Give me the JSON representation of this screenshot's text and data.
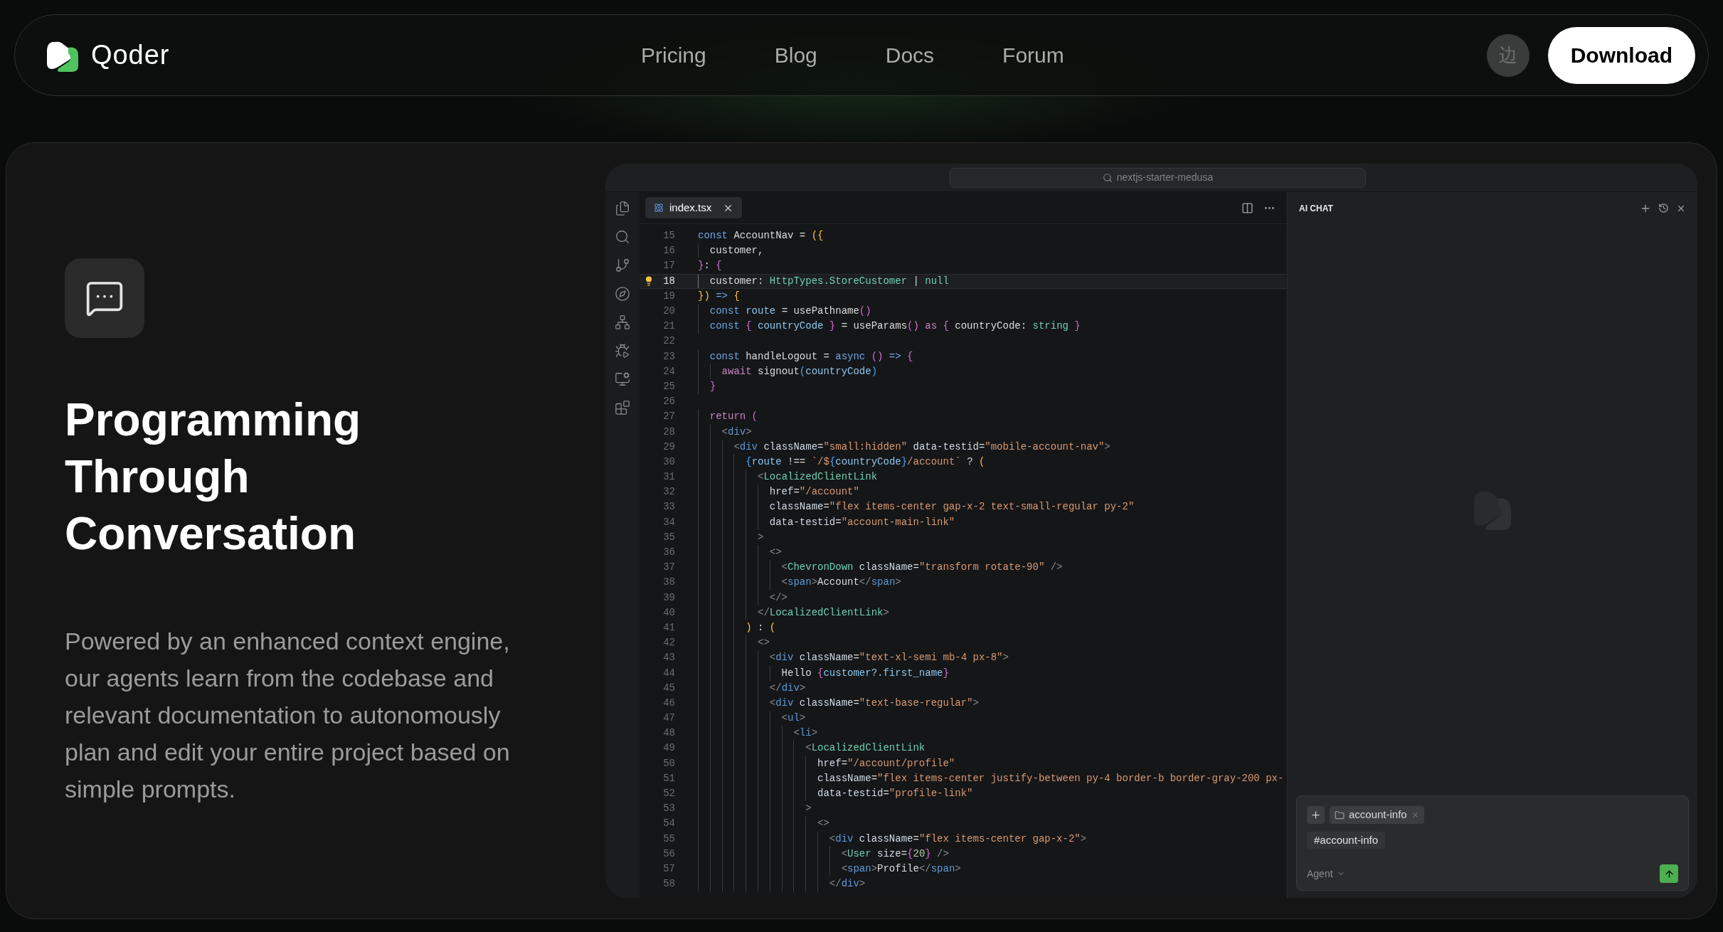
{
  "nav": {
    "brand": "Qoder",
    "links": [
      "Pricing",
      "Blog",
      "Docs",
      "Forum"
    ],
    "language_button": "边",
    "download_button": "Download"
  },
  "feature": {
    "title": "Programming Through Conversation",
    "description": "Powered by an enhanced context engine, our agents learn from the codebase and relevant documentation to autonomously plan and edit your entire project based on simple prompts."
  },
  "editor": {
    "search": "nextjs-starter-medusa",
    "tabs": [
      {
        "label": "index.tsx",
        "selected": true
      }
    ],
    "lines": [
      {
        "number": "15",
        "current": false,
        "tokens": [
          {
            "text": "const",
            "kind": "kw"
          },
          {
            "text": " AccountNav = ",
            "kind": "id"
          },
          {
            "text": "({",
            "kind": "b1"
          }
        ]
      },
      {
        "number": "16",
        "current": false,
        "tokens": [
          {
            "text": "  customer,",
            "kind": "id"
          }
        ]
      },
      {
        "number": "17",
        "current": false,
        "tokens": [
          {
            "text": "}",
            "kind": "b2"
          },
          {
            "text": ": ",
            "kind": "id"
          },
          {
            "text": "{",
            "kind": "b2"
          }
        ]
      },
      {
        "number": "18",
        "current": true,
        "tokens": [
          {
            "text": "  customer: ",
            "kind": "id"
          },
          {
            "text": "HttpTypes.StoreCustomer",
            "kind": "type"
          },
          {
            "text": " | ",
            "kind": "id"
          },
          {
            "text": "null",
            "kind": "type"
          }
        ]
      },
      {
        "number": "19",
        "current": false,
        "tokens": [
          {
            "text": "})",
            "kind": "b1"
          },
          {
            "text": " => ",
            "kind": "kw"
          },
          {
            "text": "{",
            "kind": "b1"
          }
        ]
      },
      {
        "number": "20",
        "current": false,
        "tokens": [
          {
            "text": "  const",
            "kind": "kw"
          },
          {
            "text": " route",
            "kind": "var"
          },
          {
            "text": " = usePathname",
            "kind": "id"
          },
          {
            "text": "()",
            "kind": "b2"
          }
        ]
      },
      {
        "number": "21",
        "current": false,
        "tokens": [
          {
            "text": "  const",
            "kind": "kw"
          },
          {
            "text": " {",
            "kind": "b2"
          },
          {
            "text": " countryCode ",
            "kind": "var"
          },
          {
            "text": "}",
            "kind": "b2"
          },
          {
            "text": " = useParams",
            "kind": "id"
          },
          {
            "text": "()",
            "kind": "b2"
          },
          {
            "text": " as ",
            "kind": "kw2"
          },
          {
            "text": "{",
            "kind": "b2"
          },
          {
            "text": " countryCode",
            "kind": "id"
          },
          {
            "text": ": ",
            "kind": "id"
          },
          {
            "text": "string",
            "kind": "type"
          },
          {
            "text": " }",
            "kind": "b2"
          }
        ]
      },
      {
        "number": "22",
        "current": false
      },
      {
        "number": "23",
        "current": false,
        "tokens": [
          {
            "text": "  const",
            "kind": "kw"
          },
          {
            "text": " handleLogout = ",
            "kind": "id"
          },
          {
            "text": "async",
            "kind": "kw"
          },
          {
            "text": " ()",
            "kind": "b2"
          },
          {
            "text": " =>",
            "kind": "kw"
          },
          {
            "text": " {",
            "kind": "b2"
          }
        ]
      },
      {
        "number": "24",
        "current": false,
        "tokens": [
          {
            "text": "    await",
            "kind": "kw2"
          },
          {
            "text": " signout",
            "kind": "id"
          },
          {
            "text": "(",
            "kind": "b3"
          },
          {
            "text": "countryCode",
            "kind": "var"
          },
          {
            "text": ")",
            "kind": "b3"
          }
        ]
      },
      {
        "number": "25",
        "current": false,
        "tokens": [
          {
            "text": "  }",
            "kind": "b2"
          }
        ]
      },
      {
        "number": "26",
        "current": false
      },
      {
        "number": "27",
        "current": false,
        "tokens": [
          {
            "text": "  return",
            "kind": "kw2"
          },
          {
            "text": " (",
            "kind": "b2"
          }
        ]
      },
      {
        "number": "28",
        "current": false,
        "tokens": [
          {
            "text": "    <",
            "kind": "pun"
          },
          {
            "text": "div",
            "kind": "tag"
          },
          {
            "text": ">",
            "kind": "pun"
          }
        ]
      },
      {
        "number": "29",
        "current": false,
        "tokens": [
          {
            "text": "      <",
            "kind": "pun"
          },
          {
            "text": "div",
            "kind": "tag"
          },
          {
            "text": " className",
            "kind": "attr"
          },
          {
            "text": "=",
            "kind": "id"
          },
          {
            "text": "\"small:hidden\"",
            "kind": "str"
          },
          {
            "text": " data-testid",
            "kind": "attr"
          },
          {
            "text": "=",
            "kind": "id"
          },
          {
            "text": "\"mobile-account-nav\"",
            "kind": "str"
          },
          {
            "text": ">",
            "kind": "pun"
          }
        ]
      },
      {
        "number": "30",
        "current": false,
        "tokens": [
          {
            "text": "        {",
            "kind": "b3"
          },
          {
            "text": "route",
            "kind": "var"
          },
          {
            "text": " !== ",
            "kind": "id"
          },
          {
            "text": "`/$",
            "kind": "str"
          },
          {
            "text": "{",
            "kind": "b3"
          },
          {
            "text": "countryCode",
            "kind": "var"
          },
          {
            "text": "}",
            "kind": "b3"
          },
          {
            "text": "/account`",
            "kind": "str"
          },
          {
            "text": " ? ",
            "kind": "id"
          },
          {
            "text": "(",
            "kind": "b1"
          }
        ]
      },
      {
        "number": "31",
        "current": false,
        "tokens": [
          {
            "text": "          <",
            "kind": "pun"
          },
          {
            "text": "LocalizedClientLink",
            "kind": "type"
          }
        ]
      },
      {
        "number": "32",
        "current": false,
        "tokens": [
          {
            "text": "            href",
            "kind": "attr"
          },
          {
            "text": "=",
            "kind": "id"
          },
          {
            "text": "\"/account\"",
            "kind": "str"
          }
        ]
      },
      {
        "number": "33",
        "current": false,
        "tokens": [
          {
            "text": "            className",
            "kind": "attr"
          },
          {
            "text": "=",
            "kind": "id"
          },
          {
            "text": "\"flex items-center gap-x-2 text-small-regular py-2\"",
            "kind": "str"
          }
        ]
      },
      {
        "number": "34",
        "current": false,
        "tokens": [
          {
            "text": "            data-testid",
            "kind": "attr"
          },
          {
            "text": "=",
            "kind": "id"
          },
          {
            "text": "\"account-main-link\"",
            "kind": "str"
          }
        ]
      },
      {
        "number": "35",
        "current": false,
        "tokens": [
          {
            "text": "          >",
            "kind": "pun"
          }
        ]
      },
      {
        "number": "36",
        "current": false,
        "tokens": [
          {
            "text": "            <>",
            "kind": "pun"
          }
        ]
      },
      {
        "number": "37",
        "current": false,
        "tokens": [
          {
            "text": "              <",
            "kind": "pun"
          },
          {
            "text": "ChevronDown",
            "kind": "type"
          },
          {
            "text": " className",
            "kind": "attr"
          },
          {
            "text": "=",
            "kind": "id"
          },
          {
            "text": "\"transform rotate-90\"",
            "kind": "str"
          },
          {
            "text": " />",
            "kind": "pun"
          }
        ]
      },
      {
        "number": "38",
        "current": false,
        "tokens": [
          {
            "text": "              <",
            "kind": "pun"
          },
          {
            "text": "span",
            "kind": "tag"
          },
          {
            "text": ">",
            "kind": "pun"
          },
          {
            "text": "Account",
            "kind": "id"
          },
          {
            "text": "</",
            "kind": "pun"
          },
          {
            "text": "span",
            "kind": "tag"
          },
          {
            "text": ">",
            "kind": "pun"
          }
        ]
      },
      {
        "number": "39",
        "current": false,
        "tokens": [
          {
            "text": "            </>",
            "kind": "pun"
          }
        ]
      },
      {
        "number": "40",
        "current": false,
        "tokens": [
          {
            "text": "          </",
            "kind": "pun"
          },
          {
            "text": "LocalizedClientLink",
            "kind": "type"
          },
          {
            "text": ">",
            "kind": "pun"
          }
        ]
      },
      {
        "number": "41",
        "current": false,
        "tokens": [
          {
            "text": "        )",
            "kind": "b1"
          },
          {
            "text": " : ",
            "kind": "id"
          },
          {
            "text": "(",
            "kind": "b1"
          }
        ]
      },
      {
        "number": "42",
        "current": false,
        "tokens": [
          {
            "text": "          <>",
            "kind": "pun"
          }
        ]
      },
      {
        "number": "43",
        "current": false,
        "tokens": [
          {
            "text": "            <",
            "kind": "pun"
          },
          {
            "text": "div",
            "kind": "tag"
          },
          {
            "text": " className",
            "kind": "attr"
          },
          {
            "text": "=",
            "kind": "id"
          },
          {
            "text": "\"text-xl-semi mb-4 px-8\"",
            "kind": "str"
          },
          {
            "text": ">",
            "kind": "pun"
          }
        ]
      },
      {
        "number": "44",
        "current": false,
        "tokens": [
          {
            "text": "              Hello ",
            "kind": "id"
          },
          {
            "text": "{",
            "kind": "b2"
          },
          {
            "text": "customer?.first_name",
            "kind": "var"
          },
          {
            "text": "}",
            "kind": "b2"
          }
        ]
      },
      {
        "number": "45",
        "current": false,
        "tokens": [
          {
            "text": "            </",
            "kind": "pun"
          },
          {
            "text": "div",
            "kind": "tag"
          },
          {
            "text": ">",
            "kind": "pun"
          }
        ]
      },
      {
        "number": "46",
        "current": false,
        "tokens": [
          {
            "text": "            <",
            "kind": "pun"
          },
          {
            "text": "div",
            "kind": "tag"
          },
          {
            "text": " className",
            "kind": "attr"
          },
          {
            "text": "=",
            "kind": "id"
          },
          {
            "text": "\"text-base-regular\"",
            "kind": "str"
          },
          {
            "text": ">",
            "kind": "pun"
          }
        ]
      },
      {
        "number": "47",
        "current": false,
        "tokens": [
          {
            "text": "              <",
            "kind": "pun"
          },
          {
            "text": "ul",
            "kind": "tag"
          },
          {
            "text": ">",
            "kind": "pun"
          }
        ]
      },
      {
        "number": "48",
        "current": false,
        "tokens": [
          {
            "text": "                <",
            "kind": "pun"
          },
          {
            "text": "li",
            "kind": "tag"
          },
          {
            "text": ">",
            "kind": "pun"
          }
        ]
      },
      {
        "number": "49",
        "current": false,
        "tokens": [
          {
            "text": "                  <",
            "kind": "pun"
          },
          {
            "text": "LocalizedClientLink",
            "kind": "type"
          }
        ]
      },
      {
        "number": "50",
        "current": false,
        "tokens": [
          {
            "text": "                    href",
            "kind": "attr"
          },
          {
            "text": "=",
            "kind": "id"
          },
          {
            "text": "\"/account/profile\"",
            "kind": "str"
          }
        ]
      },
      {
        "number": "51",
        "current": false,
        "tokens": [
          {
            "text": "                    className",
            "kind": "attr"
          },
          {
            "text": "=",
            "kind": "id"
          },
          {
            "text": "\"flex items-center justify-between py-4 border-b border-gray-200 px-",
            "kind": "str"
          }
        ]
      },
      {
        "number": "52",
        "current": false,
        "tokens": [
          {
            "text": "                    data-testid",
            "kind": "attr"
          },
          {
            "text": "=",
            "kind": "id"
          },
          {
            "text": "\"profile-link\"",
            "kind": "str"
          }
        ]
      },
      {
        "number": "53",
        "current": false,
        "tokens": [
          {
            "text": "                  >",
            "kind": "pun"
          }
        ]
      },
      {
        "number": "54",
        "current": false,
        "tokens": [
          {
            "text": "                    <>",
            "kind": "pun"
          }
        ]
      },
      {
        "number": "55",
        "current": false,
        "tokens": [
          {
            "text": "                      <",
            "kind": "pun"
          },
          {
            "text": "div",
            "kind": "tag"
          },
          {
            "text": " className",
            "kind": "attr"
          },
          {
            "text": "=",
            "kind": "id"
          },
          {
            "text": "\"flex items-center gap-x-2\"",
            "kind": "str"
          },
          {
            "text": ">",
            "kind": "pun"
          }
        ]
      },
      {
        "number": "56",
        "current": false,
        "tokens": [
          {
            "text": "                        <",
            "kind": "pun"
          },
          {
            "text": "User",
            "kind": "type"
          },
          {
            "text": " size",
            "kind": "attr"
          },
          {
            "text": "=",
            "kind": "id"
          },
          {
            "text": "{",
            "kind": "b2"
          },
          {
            "text": "20",
            "kind": "num"
          },
          {
            "text": "}",
            "kind": "b2"
          },
          {
            "text": " />",
            "kind": "pun"
          }
        ]
      },
      {
        "number": "57",
        "current": false,
        "tokens": [
          {
            "text": "                        <",
            "kind": "pun"
          },
          {
            "text": "span",
            "kind": "tag"
          },
          {
            "text": ">",
            "kind": "pun"
          },
          {
            "text": "Profile",
            "kind": "id"
          },
          {
            "text": "</",
            "kind": "pun"
          },
          {
            "text": "span",
            "kind": "tag"
          },
          {
            "text": ">",
            "kind": "pun"
          }
        ]
      },
      {
        "number": "58",
        "current": false,
        "tokens": [
          {
            "text": "                      </",
            "kind": "pun"
          },
          {
            "text": "div",
            "kind": "tag"
          },
          {
            "text": ">",
            "kind": "pun"
          }
        ]
      }
    ]
  },
  "chat": {
    "title": "AI CHAT",
    "context_chip": "account-info",
    "tag": "#account-info",
    "mode": "Agent"
  }
}
